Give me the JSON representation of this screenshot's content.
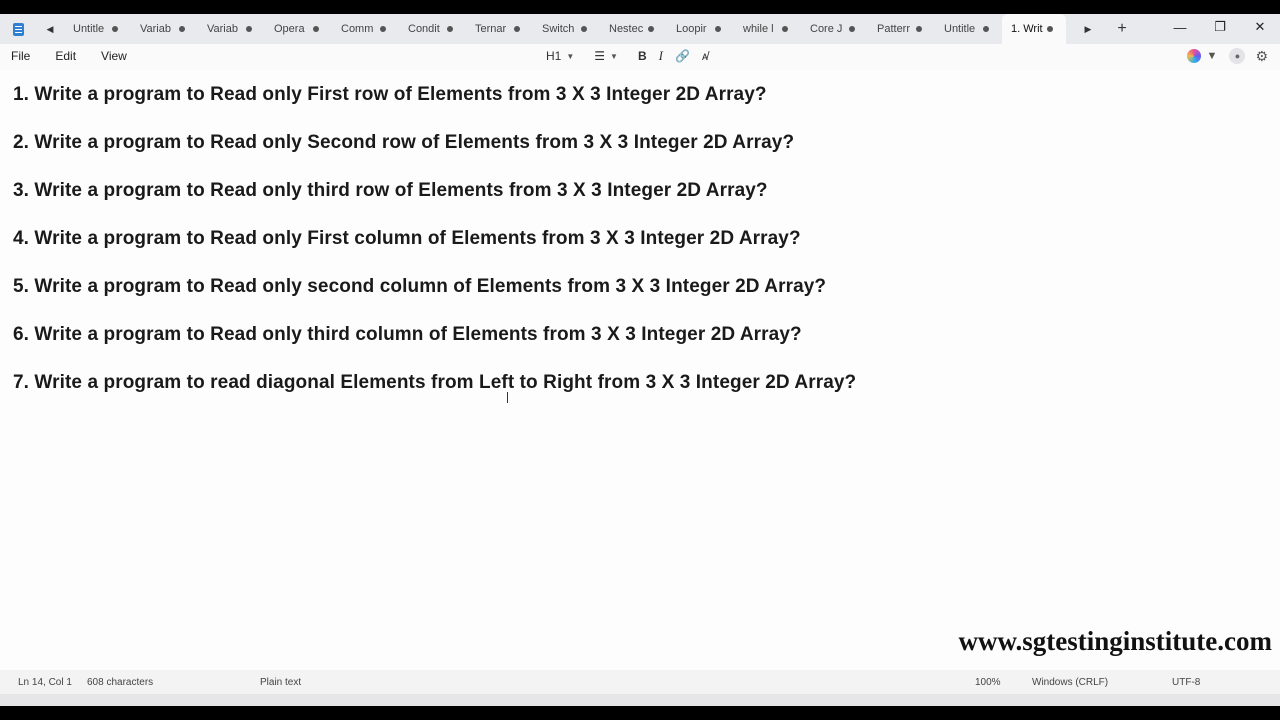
{
  "tabs": [
    {
      "label": "Untitle"
    },
    {
      "label": "Variab"
    },
    {
      "label": "Variab"
    },
    {
      "label": "Opera"
    },
    {
      "label": "Comm"
    },
    {
      "label": "Condit"
    },
    {
      "label": "Ternar"
    },
    {
      "label": "Switch"
    },
    {
      "label": "Nestec"
    },
    {
      "label": "Loopir"
    },
    {
      "label": "while l"
    },
    {
      "label": "Core J"
    },
    {
      "label": "Patterr"
    },
    {
      "label": "Untitle"
    },
    {
      "label": "1. Writ"
    }
  ],
  "menu": {
    "file": "File",
    "edit": "Edit",
    "view": "View"
  },
  "toolbar": {
    "heading": "H1",
    "bold": "B",
    "italic": "I"
  },
  "content": {
    "lines": [
      "1. Write a program to Read only First row of Elements from 3 X 3 Integer 2D Array?",
      "2. Write a program to Read only Second row of Elements from 3 X 3 Integer 2D Array?",
      "3. Write a program to Read only third row of Elements from 3 X 3 Integer 2D Array?",
      "4. Write a program to Read only First column of Elements from 3 X 3 Integer 2D Array?",
      "5. Write a program to Read only second column of Elements from 3 X 3 Integer 2D Array?",
      "6. Write a program to Read only third column of Elements from 3 X 3 Integer 2D Array?",
      "7. Write a program to read diagonal Elements from Left to Right from 3 X 3 Integer 2D Array?"
    ],
    "watermark": "www.sgtestinginstitute.com"
  },
  "status": {
    "position": "Ln 14, Col 1",
    "characters": "608 characters",
    "format": "Plain text",
    "zoom": "100%",
    "line_ending": "Windows (CRLF)",
    "encoding": "UTF-8"
  }
}
